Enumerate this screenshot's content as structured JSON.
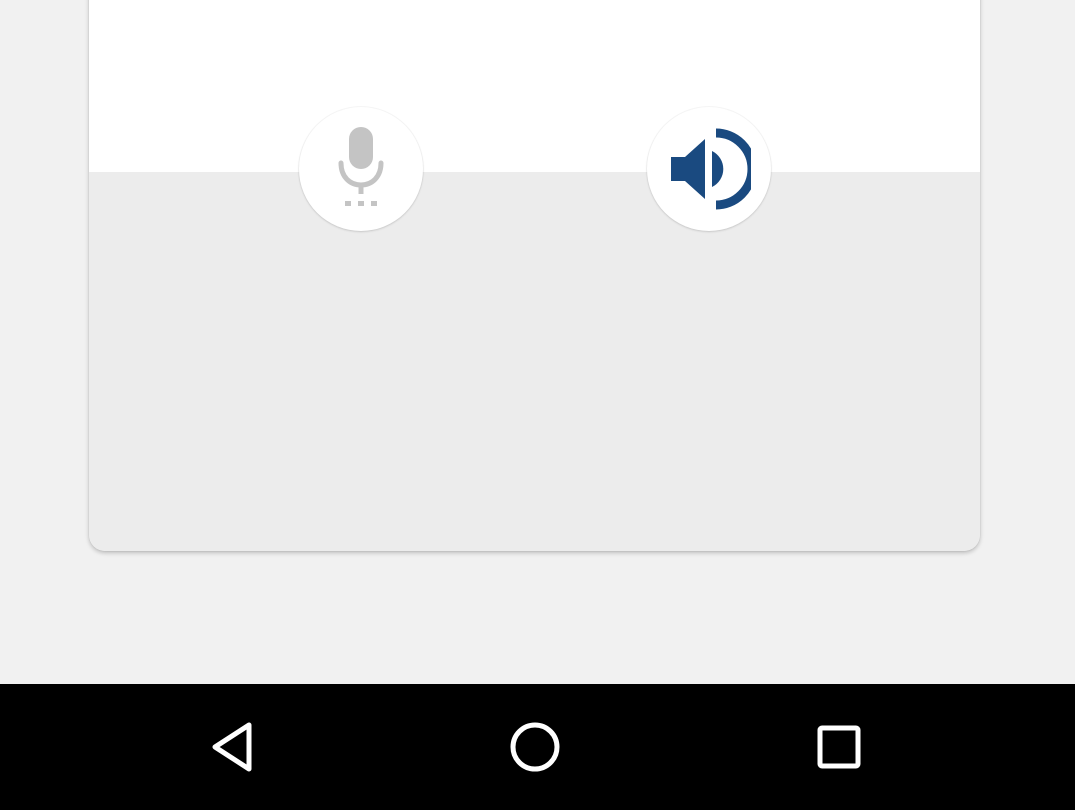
{
  "colors": {
    "background": "#f1f1f1",
    "card_top": "#ffffff",
    "card_bottom": "#ececec",
    "mic_icon": "#c4c4c4",
    "speaker_icon": "#1a4a80",
    "navbar": "#000000",
    "nav_icon": "#ffffff"
  },
  "voice_controls": {
    "mic_button": {
      "icon": "mic-icon",
      "state": "disabled"
    },
    "speaker_button": {
      "icon": "speaker-icon",
      "state": "active"
    }
  },
  "navigation_bar": {
    "buttons": [
      {
        "icon": "back-triangle-icon"
      },
      {
        "icon": "home-circle-icon"
      },
      {
        "icon": "recents-square-icon"
      }
    ]
  }
}
